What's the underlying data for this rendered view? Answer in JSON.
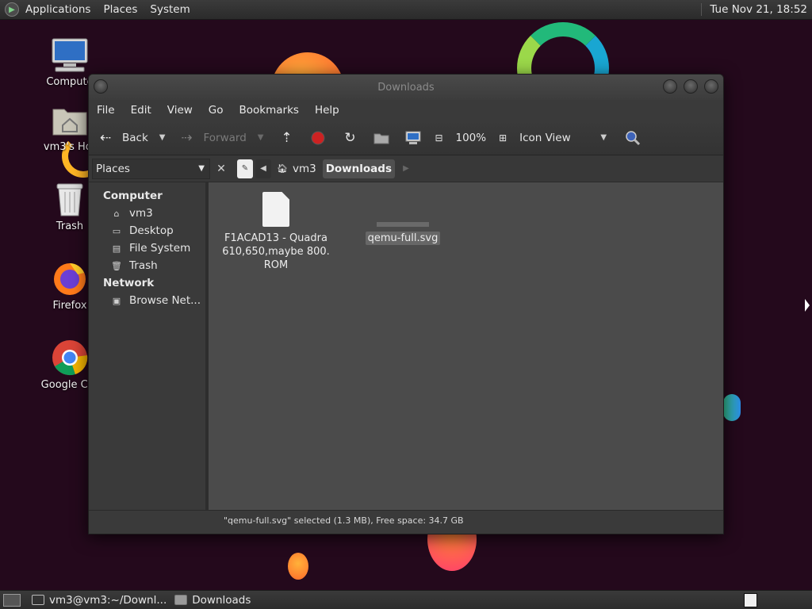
{
  "top_panel": {
    "menus": [
      "Applications",
      "Places",
      "System"
    ],
    "clock": "Tue Nov 21, 18:52"
  },
  "desktop": {
    "icons": [
      {
        "label": "Compute",
        "icon": "computer-icon"
      },
      {
        "label": "vm3's Hor",
        "icon": "home-folder-icon"
      },
      {
        "label": "Trash",
        "icon": "trash-icon"
      },
      {
        "label": "Firefox",
        "icon": "firefox-icon"
      },
      {
        "label": "Google Chr",
        "icon": "chrome-icon"
      }
    ]
  },
  "window": {
    "title": "Downloads",
    "menubar": [
      "File",
      "Edit",
      "View",
      "Go",
      "Bookmarks",
      "Help"
    ],
    "toolbar": {
      "back": "Back",
      "forward": "Forward",
      "zoom": "100%",
      "view_mode": "Icon View"
    },
    "places_label": "Places",
    "breadcrumbs": [
      "vm3",
      "Downloads"
    ],
    "sidebar": {
      "sections": [
        {
          "heading": "Computer",
          "items": [
            "vm3",
            "Desktop",
            "File System",
            "Trash"
          ]
        },
        {
          "heading": "Network",
          "items": [
            "Browse Net..."
          ]
        }
      ]
    },
    "files": [
      {
        "name": "F1ACAD13 - Quadra 610,650,maybe 800. ROM",
        "selected": false
      },
      {
        "name": "qemu-full.svg",
        "selected": true
      }
    ],
    "status": "\"qemu-full.svg\" selected (1.3 MB), Free space: 34.7 GB"
  },
  "bottom_panel": {
    "tasks": [
      "vm3@vm3:~/Downl...",
      "Downloads"
    ]
  },
  "colors": {
    "wallpaper": "#24091c",
    "panel": "#333333",
    "content": "#4b4b4b",
    "selection": "#676767"
  }
}
